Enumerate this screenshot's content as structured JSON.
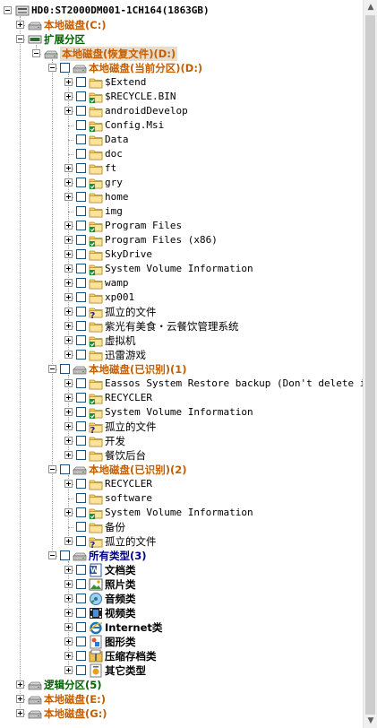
{
  "tree": {
    "disk": "HD0:ST2000DM001-1CH164(1863GB)",
    "drive_c": "本地磁盘(C:)",
    "extended": "扩展分区",
    "drive_d": "本地磁盘(恢复文件)(D:)",
    "current": "本地磁盘(当前分区)(D:)",
    "current_items": [
      "$Extend",
      "$RECYCLE.BIN",
      "androidDevelop",
      "Config.Msi",
      "Data",
      "doc",
      "ft",
      "gry",
      "home",
      "img",
      "Program Files",
      "Program Files (x86)",
      "SkyDrive",
      "System Volume Information",
      "wamp",
      "xp001",
      "孤立的文件",
      "紫光有美食・云餐饮管理系统",
      "虚拟机",
      "迅雷游戏"
    ],
    "recog1": "本地磁盘(已识别)(1)",
    "recog1_items": [
      "Eassos System Restore backup (Don't delete it)",
      "RECYCLER",
      "System Volume Information",
      "孤立的文件",
      "开发",
      "餐饮后台"
    ],
    "recog2": "本地磁盘(已识别)(2)",
    "recog2_items": [
      "RECYCLER",
      "software",
      "System Volume Information",
      "备份",
      "孤立的文件"
    ],
    "all_types": "所有类型(3)",
    "type_items": [
      "文档类",
      "照片类",
      "音频类",
      "视频类",
      "Internet类",
      "图形类",
      "压缩存档类",
      "其它类型"
    ],
    "logical": "逻辑分区(5)",
    "drive_e": "本地磁盘(E:)",
    "drive_g": "本地磁盘(G:)"
  },
  "colors": {
    "drive_label": "#c45e00",
    "extended_label": "#006400",
    "types_label": "#00008b",
    "selection": "#e8dccc",
    "folder": "#f7d26b"
  },
  "icons": {
    "disk": "hard-disk-icon",
    "drive": "drive-icon",
    "folder": "folder-icon",
    "folder_deleted": "folder-with-deleted-mark-icon",
    "orphan": "question-mark-folder-icon",
    "types": [
      "word-doc-icon",
      "photo-icon",
      "audio-icon",
      "video-icon",
      "internet-explorer-icon",
      "graphics-icon",
      "archive-icon",
      "other-types-icon"
    ]
  }
}
